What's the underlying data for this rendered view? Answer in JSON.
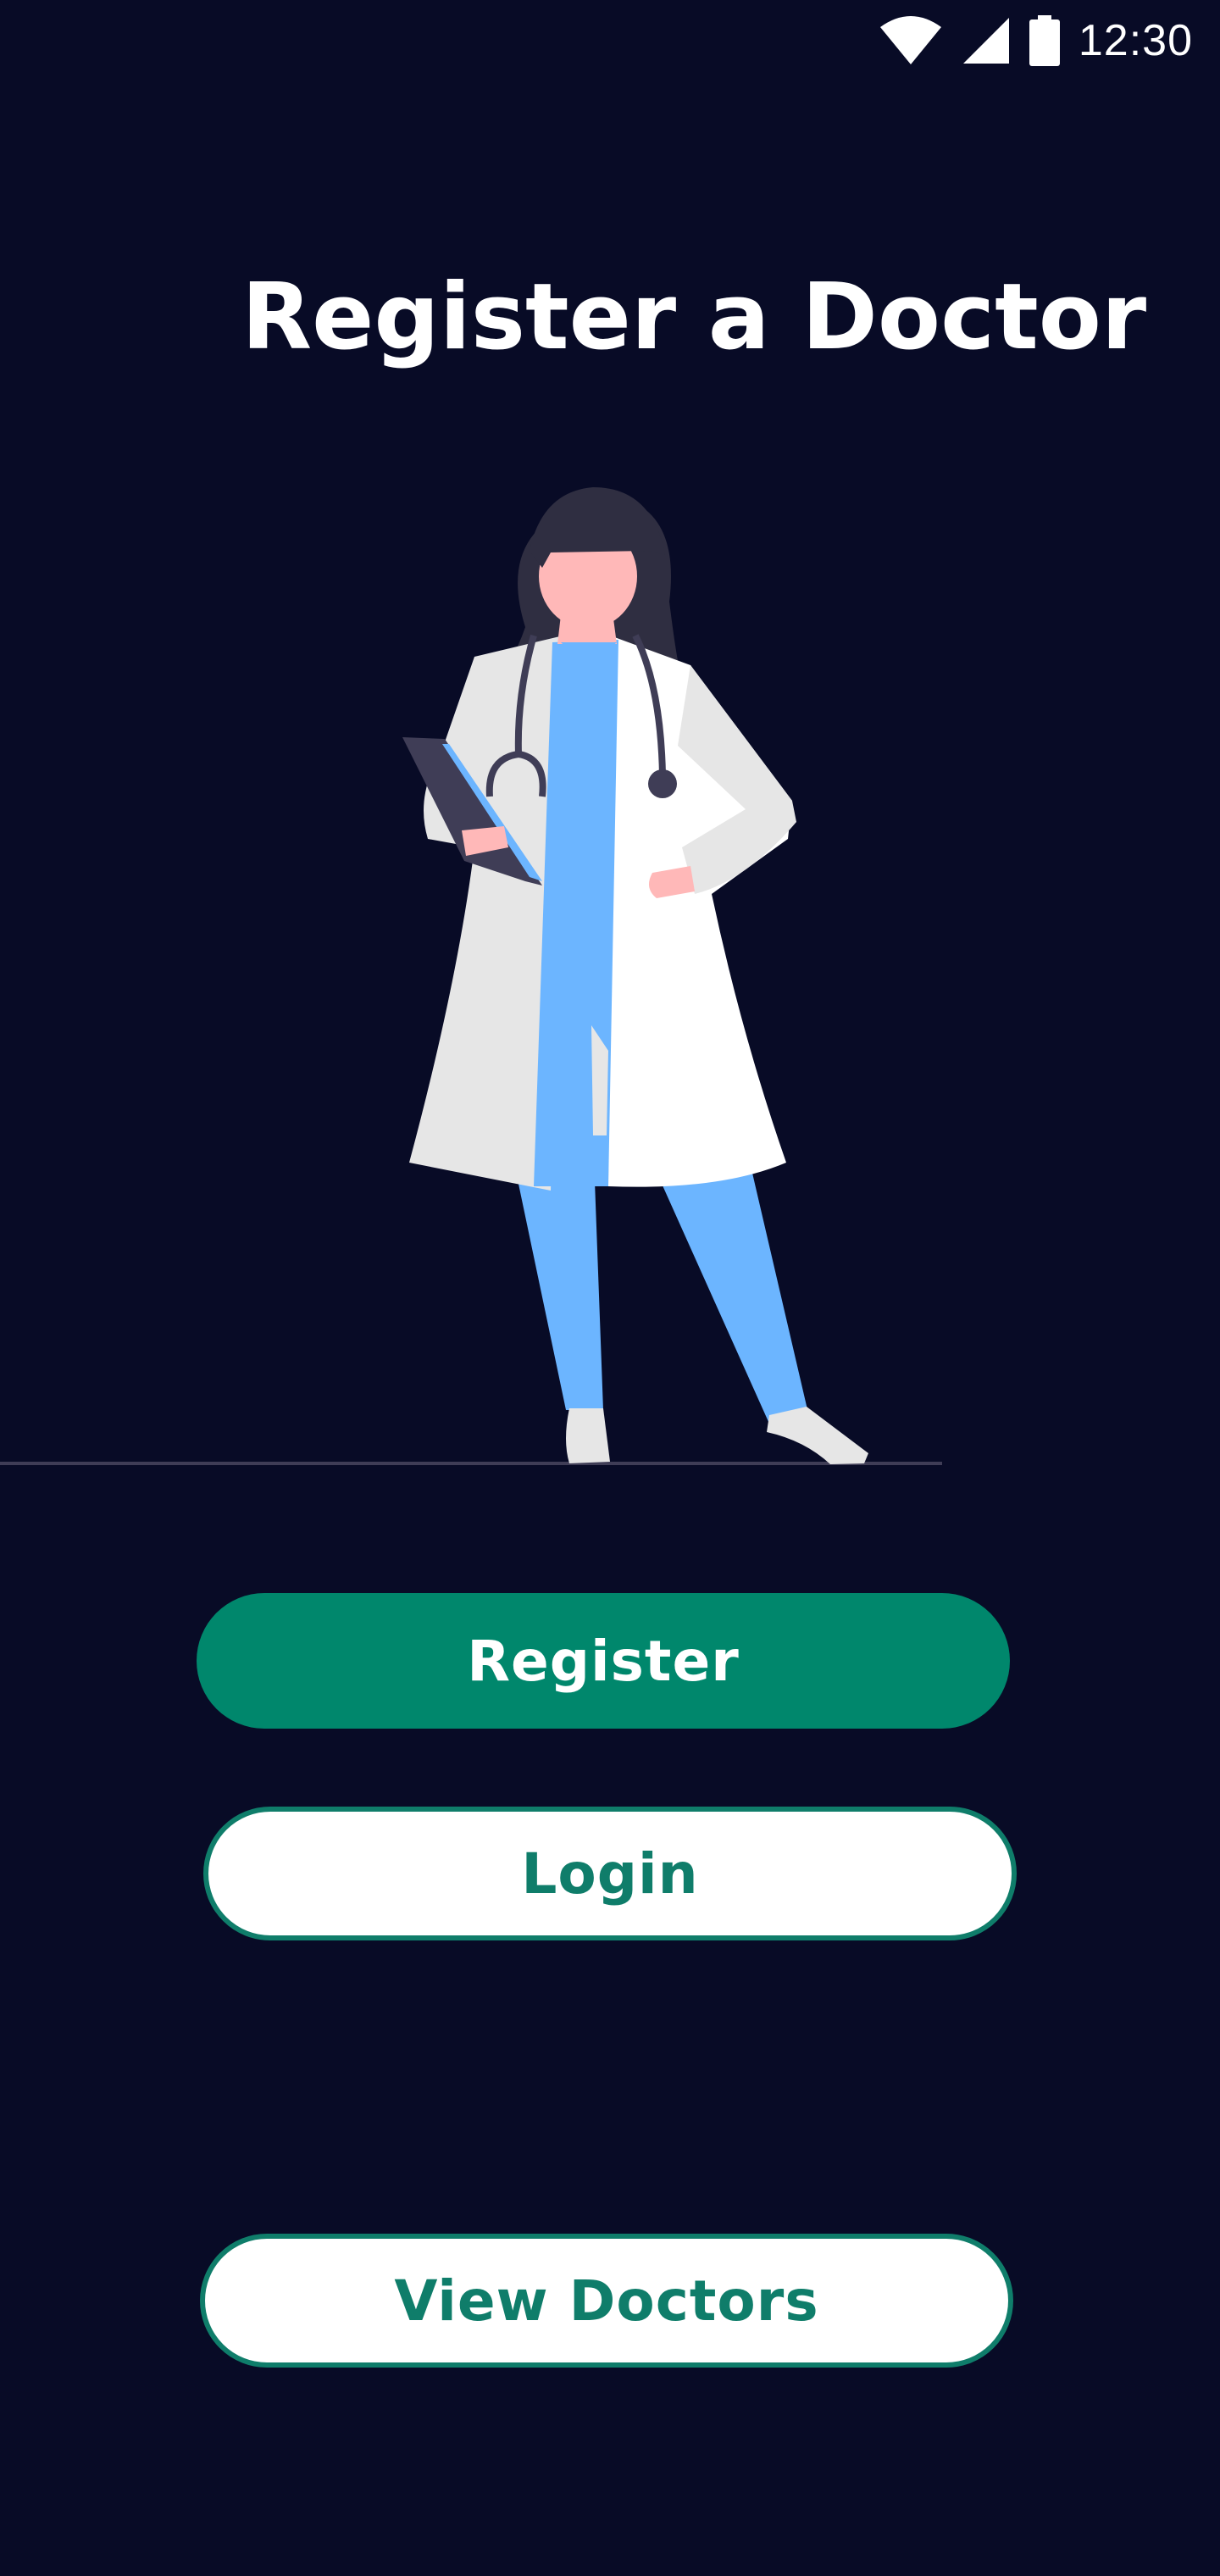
{
  "status_bar": {
    "time": "12:30",
    "icons": [
      "wifi-icon",
      "signal-icon",
      "battery-icon"
    ]
  },
  "title": "Register a Doctor",
  "illustration": {
    "subject": "doctor-illustration"
  },
  "buttons": {
    "register_label": "Register",
    "login_label": "Login",
    "view_doctors_label": "View Doctors"
  },
  "colors": {
    "background": "#080b26",
    "primary": "#00876c",
    "outline": "#0f7d6a",
    "scrubs": "#6cb5ff",
    "coat": "#ffffff",
    "hair": "#2f2e41"
  }
}
